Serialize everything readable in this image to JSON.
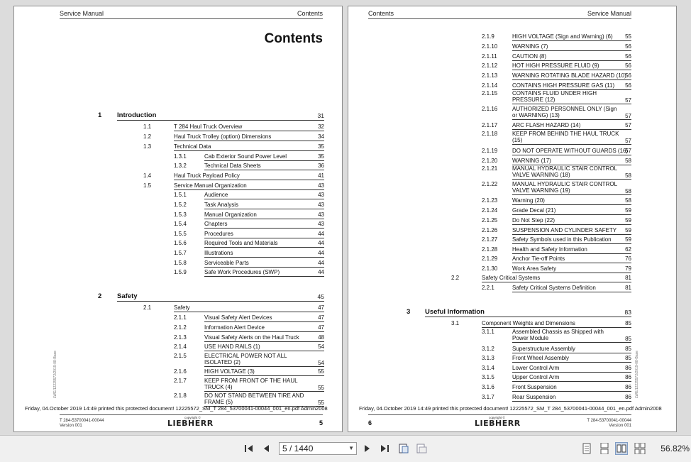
{
  "left_page": {
    "header_left": "Service Manual",
    "header_right": "Contents",
    "title": "Contents",
    "chapters": [
      {
        "num": "1",
        "title": "Introduction",
        "page": "31",
        "entries": [
          {
            "num": "1.1",
            "title": "T 284 Haul Truck Overview",
            "page": "32"
          },
          {
            "num": "1.2",
            "title": "Haul Truck Trolley (option) Dimensions",
            "page": "34"
          },
          {
            "num": "1.3",
            "title": "Technical Data",
            "page": "35",
            "subs": [
              {
                "num": "1.3.1",
                "title": "Cab Exterior Sound Power Level",
                "page": "35"
              },
              {
                "num": "1.3.2",
                "title": "Technical Data Sheets",
                "page": "36"
              }
            ]
          },
          {
            "num": "1.4",
            "title": "Haul Truck Payload Policy",
            "page": "41"
          },
          {
            "num": "1.5",
            "title": "Service Manual Organization",
            "page": "43",
            "subs": [
              {
                "num": "1.5.1",
                "title": "Audience",
                "page": "43"
              },
              {
                "num": "1.5.2",
                "title": "Task Analysis",
                "page": "43"
              },
              {
                "num": "1.5.3",
                "title": "Manual Organization",
                "page": "43"
              },
              {
                "num": "1.5.4",
                "title": "Chapters",
                "page": "43"
              },
              {
                "num": "1.5.5",
                "title": "Procedures",
                "page": "44"
              },
              {
                "num": "1.5.6",
                "title": "Required Tools and Materials",
                "page": "44"
              },
              {
                "num": "1.5.7",
                "title": "Illustrations",
                "page": "44"
              },
              {
                "num": "1.5.8",
                "title": "Serviceable Parts",
                "page": "44"
              },
              {
                "num": "1.5.9",
                "title": "Safe Work Procedures (SWP)",
                "page": "44"
              }
            ]
          }
        ]
      },
      {
        "num": "2",
        "title": "Safety",
        "page": "45",
        "entries": [
          {
            "num": "2.1",
            "title": "Safety",
            "page": "47",
            "subs": [
              {
                "num": "2.1.1",
                "title": "Visual Safety Alert Devices",
                "page": "47"
              },
              {
                "num": "2.1.2",
                "title": "Information Alert Device",
                "page": "47"
              },
              {
                "num": "2.1.3",
                "title": "Visual Safety Alerts on the Haul Truck",
                "page": "48"
              },
              {
                "num": "2.1.4",
                "title": "USE HAND RAILS (1)",
                "page": "54"
              },
              {
                "num": "2.1.5",
                "title": "ELECTRICAL POWER NOT ALL ISOLATED (2)",
                "page": "54"
              },
              {
                "num": "2.1.6",
                "title": "HIGH VOLTAGE (3)",
                "page": "55"
              },
              {
                "num": "2.1.7",
                "title": "KEEP FROM FRONT OF THE HAUL TRUCK (4)",
                "page": "55"
              },
              {
                "num": "2.1.8",
                "title": "DO NOT STAND BETWEEN TIRE AND FRAME (5)",
                "page": "55"
              }
            ]
          }
        ]
      }
    ],
    "printed_note": "Friday, 04.October 2019 14:49 printed this protected document! 12225572_SM_T 284_53700041-00044_001_en.pdf Admin2008",
    "footer_code": "T 284-53700041-00044",
    "footer_version": "Version 001",
    "copyright": "copyright ©",
    "logo": "LIEBHERR",
    "page_number": "5",
    "side_code": "LWE/12225572/2019-08-Base"
  },
  "right_page": {
    "header_left": "Contents",
    "header_right": "Service Manual",
    "entries": [
      {
        "num": "2.1.9",
        "title": "HIGH VOLTAGE (Sign and Warning) (6)",
        "page": "55"
      },
      {
        "num": "2.1.10",
        "title": "WARNING (7)",
        "page": "56"
      },
      {
        "num": "2.1.11",
        "title": "CAUTION (8)",
        "page": "56"
      },
      {
        "num": "2.1.12",
        "title": "HOT HIGH PRESSURE FLUID (9)",
        "page": "56"
      },
      {
        "num": "2.1.13",
        "title": "WARNING ROTATING BLADE HAZARD (10)",
        "page": "56"
      },
      {
        "num": "2.1.14",
        "title": "CONTAINS HIGH PRESSURE GAS (11)",
        "page": "56"
      },
      {
        "num": "2.1.15",
        "title": "CONTAINS FLUID UNDER HIGH PRESSURE (12)",
        "page": "57"
      },
      {
        "num": "2.1.16",
        "title": "AUTHORIZED PERSONNEL ONLY (Sign or WARNING) (13)",
        "page": "57"
      },
      {
        "num": "2.1.17",
        "title": "ARC FLASH HAZARD (14)",
        "page": "57"
      },
      {
        "num": "2.1.18",
        "title": "KEEP FROM BEHIND THE HAUL TRUCK (15)",
        "page": "57"
      },
      {
        "num": "2.1.19",
        "title": "DO NOT OPERATE WITHOUT GUARDS (16)",
        "page": "57"
      },
      {
        "num": "2.1.20",
        "title": "WARNING (17)",
        "page": "58"
      },
      {
        "num": "2.1.21",
        "title": "MANUAL HYDRAULIC STAIR CONTROL VALVE WARNING (18)",
        "page": "58"
      },
      {
        "num": "2.1.22",
        "title": "MANUAL HYDRAULIC STAIR CONTROL VALVE WARNING (19)",
        "page": "58"
      },
      {
        "num": "2.1.23",
        "title": "Warning (20)",
        "page": "58"
      },
      {
        "num": "2.1.24",
        "title": "Grade Decal (21)",
        "page": "59"
      },
      {
        "num": "2.1.25",
        "title": "Do Not Step (22)",
        "page": "59"
      },
      {
        "num": "2.1.26",
        "title": "SUSPENSION AND CYLINDER SAFETY",
        "page": "59"
      },
      {
        "num": "2.1.27",
        "title": "Safety Symbols used in this Publication",
        "page": "59"
      },
      {
        "num": "2.1.28",
        "title": "Health and Safety Information",
        "page": "62"
      },
      {
        "num": "2.1.29",
        "title": "Anchor Tie-off Points",
        "page": "76"
      },
      {
        "num": "2.1.30",
        "title": "Work Area Safety",
        "page": "79"
      }
    ],
    "section_2_2": {
      "num": "2.2",
      "title": "Safety Critical Systems",
      "page": "81"
    },
    "section_2_2_1": {
      "num": "2.2.1",
      "title": "Safety Critical Systems Definition",
      "page": "81"
    },
    "chapter3": {
      "num": "3",
      "title": "Useful Information",
      "page": "83"
    },
    "section_3_1": {
      "num": "3.1",
      "title": "Component Weights and Dimensions",
      "page": "85"
    },
    "ch3_entries": [
      {
        "num": "3.1.1",
        "title": "Assembled Chassis as Shipped with Power Module",
        "page": "85"
      },
      {
        "num": "3.1.2",
        "title": "Superstructure Assembly",
        "page": "85"
      },
      {
        "num": "3.1.3",
        "title": "Front Wheel Assembly",
        "page": "85"
      },
      {
        "num": "3.1.4",
        "title": "Lower Control Arm",
        "page": "86"
      },
      {
        "num": "3.1.5",
        "title": "Upper Control Arm",
        "page": "86"
      },
      {
        "num": "3.1.6",
        "title": "Front Suspension",
        "page": "86"
      },
      {
        "num": "3.1.7",
        "title": "Rear Suspension",
        "page": "86"
      }
    ],
    "printed_note": "Friday, 04.October 2019 14:49 printed this protected document! 12225572_SM_T 284_53700041-00044_001_en.pdf Admin2008",
    "footer_code": "T 284-53700041-00044",
    "footer_version": "Version 001",
    "copyright": "copyright ©",
    "logo": "LIEBHERR",
    "page_number": "6",
    "side_code": "LWE/12225572/2019-08-Base"
  },
  "toolbar": {
    "page_indicator": "5 / 1440",
    "zoom": "56.82%",
    "icons": [
      "first-page-icon",
      "previous-page-icon",
      "next-page-icon",
      "last-page-icon",
      "fit-page-icon",
      "fit-width-icon",
      "single-page-icon",
      "continuous-icon",
      "two-page-icon",
      "two-page-continuous-icon"
    ]
  }
}
